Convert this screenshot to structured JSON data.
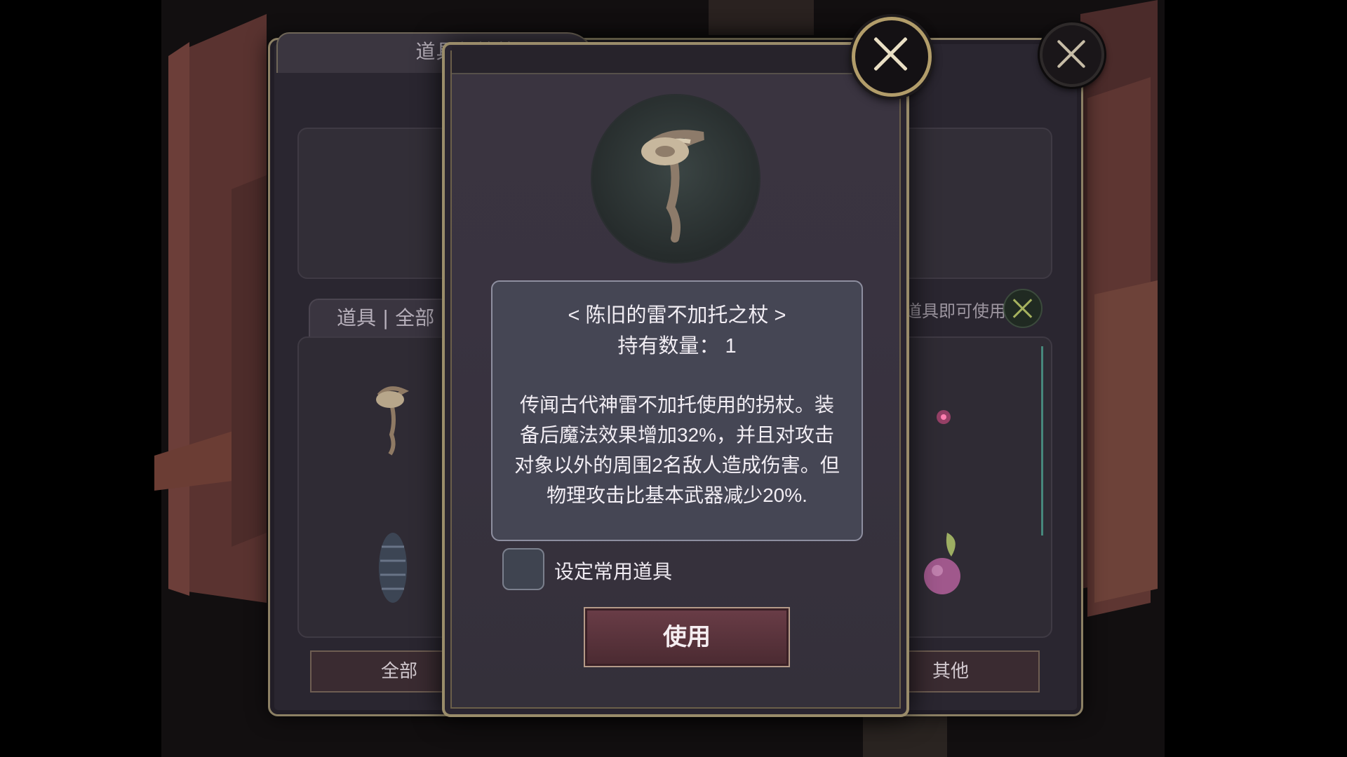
{
  "back_panel": {
    "title": "道具保管箱",
    "category_label": "道具 | 全部",
    "hint": "点击道具即可使用",
    "tab_all": "全部",
    "tab_other": "其他"
  },
  "dialog": {
    "item_name": "< 陈旧的雷不加托之杖 >",
    "quantity": "持有数量： 1",
    "description": "传闻古代神雷不加托使用的拐杖。装备后魔法效果增加32%，并且对攻击对象以外的周围2名敌人造成伤害。但物理攻击比基本武器减少20%.",
    "checkbox_label": "设定常用道具",
    "use_button": "使用"
  },
  "icons": {
    "close": "close-x-icon",
    "staff": "staff-item-icon",
    "fish": "fish-item-icon",
    "fruit": "fruit-item-icon",
    "berry": "berry-item-icon"
  },
  "colors": {
    "frame_gold": "#9a8c6a",
    "use_button": "#5a323b",
    "desc_panel": "#454654"
  }
}
